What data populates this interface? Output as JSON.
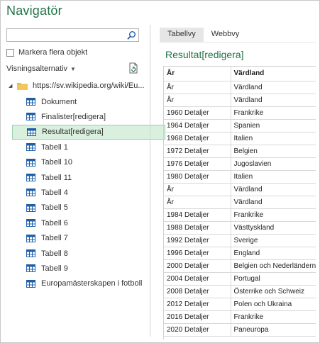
{
  "window": {
    "title": "Navigatör"
  },
  "search": {
    "value": "",
    "placeholder": ""
  },
  "options": {
    "select_multiple_label": "Markera flera objekt",
    "display_options_label": "Visningsalternativ"
  },
  "tree": {
    "root_label": "https://sv.wikipedia.org/wiki/Eu...",
    "items": [
      {
        "label": "Dokument",
        "selected": false
      },
      {
        "label": "Finalister[redigera]",
        "selected": false
      },
      {
        "label": "Resultat[redigera]",
        "selected": true
      },
      {
        "label": "Tabell 1",
        "selected": false
      },
      {
        "label": "Tabell 10",
        "selected": false
      },
      {
        "label": "Tabell 11",
        "selected": false
      },
      {
        "label": "Tabell 4",
        "selected": false
      },
      {
        "label": "Tabell 5",
        "selected": false
      },
      {
        "label": "Tabell 6",
        "selected": false
      },
      {
        "label": "Tabell 7",
        "selected": false
      },
      {
        "label": "Tabell 8",
        "selected": false
      },
      {
        "label": "Tabell 9",
        "selected": false
      },
      {
        "label": "Europamästerskapen i fotboll",
        "selected": false
      }
    ]
  },
  "tabs": [
    {
      "label": "Tabellvy",
      "active": true
    },
    {
      "label": "Webbvy",
      "active": false
    }
  ],
  "preview": {
    "title": "Resultat[redigera]",
    "columns": [
      "År",
      "Värdland"
    ],
    "rows": [
      [
        "År",
        "Värdland"
      ],
      [
        "År",
        "Värdland"
      ],
      [
        "1960 Detaljer",
        "Frankrike"
      ],
      [
        "1964 Detaljer",
        "Spanien"
      ],
      [
        "1968 Detaljer",
        "Italien"
      ],
      [
        "1972 Detaljer",
        "Belgien"
      ],
      [
        "1976 Detaljer",
        "Jugoslavien"
      ],
      [
        "1980 Detaljer",
        "Italien"
      ],
      [
        "År",
        "Värdland"
      ],
      [
        "År",
        "Värdland"
      ],
      [
        "1984 Detaljer",
        "Frankrike"
      ],
      [
        "1988 Detaljer",
        "Västtyskland"
      ],
      [
        "1992 Detaljer",
        "Sverige"
      ],
      [
        "1996 Detaljer",
        "England"
      ],
      [
        "2000 Detaljer",
        "Belgien och Nederländerna"
      ],
      [
        "2004 Detaljer",
        "Portugal"
      ],
      [
        "2008 Detaljer",
        "Österrike och Schweiz"
      ],
      [
        "2012 Detaljer",
        "Polen och Ukraina"
      ],
      [
        "2016 Detaljer",
        "Frankrike"
      ],
      [
        "2020 Detaljer",
        "Paneuropa"
      ]
    ]
  },
  "colors": {
    "accent": "#217346",
    "selection": "#d9f0df",
    "selection_border": "#9ccfaa"
  },
  "icons": [
    "search-icon",
    "refresh-icon",
    "folder-icon",
    "table-icon",
    "expander-icon",
    "caret-down-icon"
  ]
}
